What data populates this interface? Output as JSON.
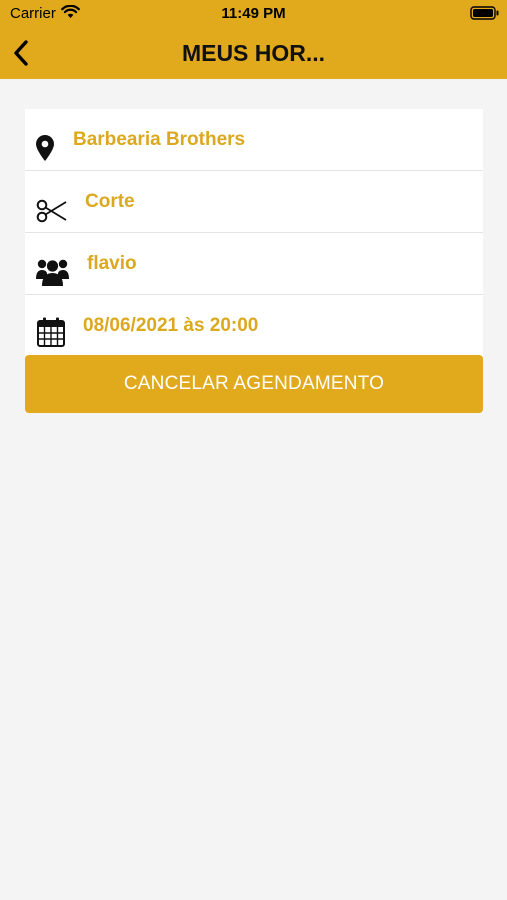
{
  "status_bar": {
    "carrier": "Carrier",
    "time": "11:49 PM"
  },
  "nav": {
    "title": "MEUS HOR..."
  },
  "appointment": {
    "location": "Barbearia Brothers",
    "service": "Corte",
    "professional": "flavio",
    "datetime": "08/06/2021 às 20:00"
  },
  "actions": {
    "cancel_label": "CANCELAR AGENDAMENTO"
  },
  "colors": {
    "accent": "#e0aa1c",
    "label_text": "#dba91f",
    "background": "#f4f4f4"
  },
  "icons": [
    "wifi-icon",
    "battery-icon",
    "back-chevron-icon",
    "map-pin-icon",
    "scissors-icon",
    "people-icon",
    "calendar-icon"
  ]
}
